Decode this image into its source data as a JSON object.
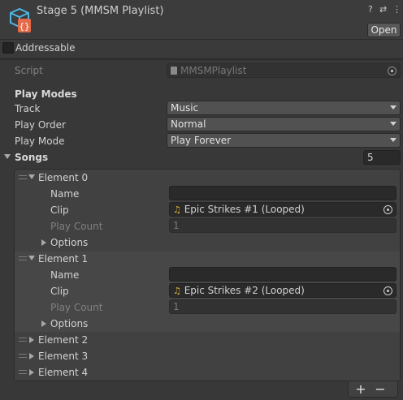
{
  "header": {
    "title": "Stage 5 (MMSM Playlist)",
    "open_label": "Open",
    "icons": [
      "help-icon",
      "preset-icon",
      "more-icon"
    ],
    "help_glyph": "?",
    "preset_glyph": "⇄",
    "more_glyph": "⋮"
  },
  "addressable": {
    "label": "Addressable",
    "checked": false
  },
  "script": {
    "label": "Script",
    "value": "MMSMPlaylist"
  },
  "play_modes": {
    "heading": "Play Modes",
    "track": {
      "label": "Track",
      "value": "Music"
    },
    "play_order": {
      "label": "Play Order",
      "value": "Normal"
    },
    "play_mode": {
      "label": "Play Mode",
      "value": "Play Forever"
    }
  },
  "songs": {
    "label": "Songs",
    "count": "5",
    "elements": [
      {
        "label": "Element 0",
        "expanded": true,
        "name_label": "Name",
        "name_value": "",
        "clip_label": "Clip",
        "clip_value": "Epic Strikes #1 (Looped)",
        "play_count_label": "Play Count",
        "play_count_value": "1",
        "options_label": "Options"
      },
      {
        "label": "Element 1",
        "expanded": true,
        "name_label": "Name",
        "name_value": "",
        "clip_label": "Clip",
        "clip_value": "Epic Strikes #2 (Looped)",
        "play_count_label": "Play Count",
        "play_count_value": "1",
        "options_label": "Options"
      },
      {
        "label": "Element 2",
        "expanded": false
      },
      {
        "label": "Element 3",
        "expanded": false
      },
      {
        "label": "Element 4",
        "expanded": false
      }
    ],
    "add_label": "+",
    "remove_label": "−"
  },
  "colors": {
    "background": "#383838",
    "field": "#2a2a2a",
    "dropdown": "#515151",
    "audio_icon": "#e8b93a"
  }
}
